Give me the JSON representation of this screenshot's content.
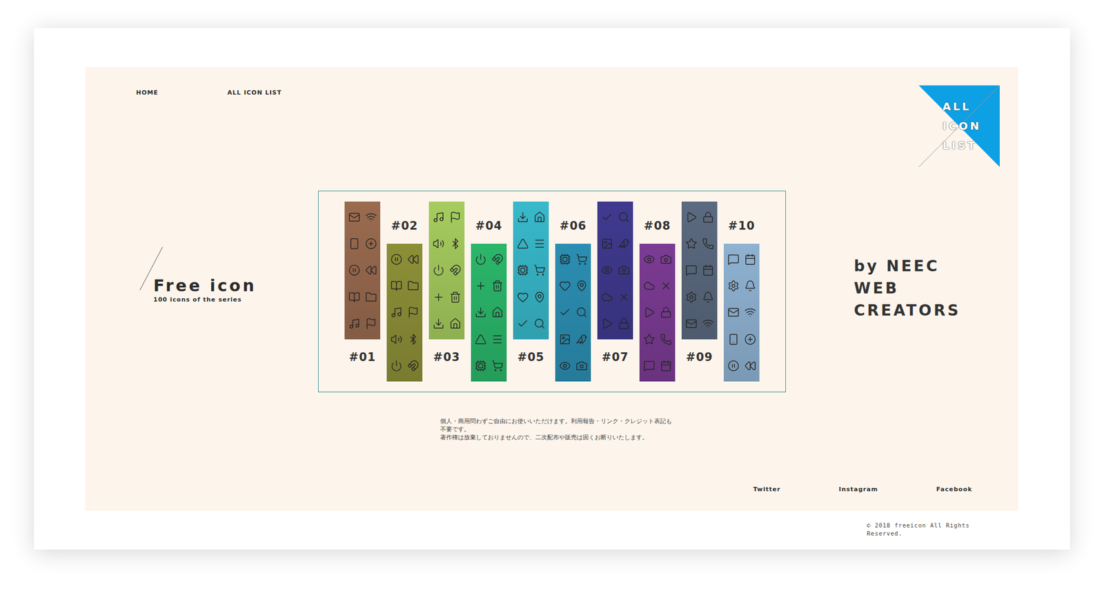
{
  "nav": [
    {
      "label": "HOME"
    },
    {
      "label": "ALL ICON LIST"
    }
  ],
  "corner_badge": {
    "lines": [
      "ALL",
      "ICON",
      "LIST"
    ]
  },
  "hero": {
    "title": "Free icon",
    "subtitle": "100 icons of the series"
  },
  "series": [
    {
      "label": "#01",
      "color": "#9a6b4f"
    },
    {
      "label": "#02",
      "color": "#8d8f37"
    },
    {
      "label": "#03",
      "color": "#a6cc5e"
    },
    {
      "label": "#04",
      "color": "#2bb66a"
    },
    {
      "label": "#05",
      "color": "#38b9cb"
    },
    {
      "label": "#06",
      "color": "#2b8eb2"
    },
    {
      "label": "#07",
      "color": "#3f3a8f"
    },
    {
      "label": "#08",
      "color": "#7b3b93"
    },
    {
      "label": "#09",
      "color": "#5b6a80"
    },
    {
      "label": "#10",
      "color": "#8fb2d2"
    }
  ],
  "creators": {
    "lines": [
      "by NEEC",
      "WEB",
      "CREATORS"
    ]
  },
  "description": {
    "lines": [
      "個人・商用問わずご自由にお使いいただけます。利用報告・リンク・クレジット表記も",
      "不要です。",
      "著作権は放棄しておりませんので、二次配布や販売は固くお断りいたします。"
    ]
  },
  "social": [
    {
      "label": "Twitter"
    },
    {
      "label": "Instagram"
    },
    {
      "label": "Facebook"
    }
  ],
  "copyright": "© 2018 freeicon All Rights Reserved."
}
